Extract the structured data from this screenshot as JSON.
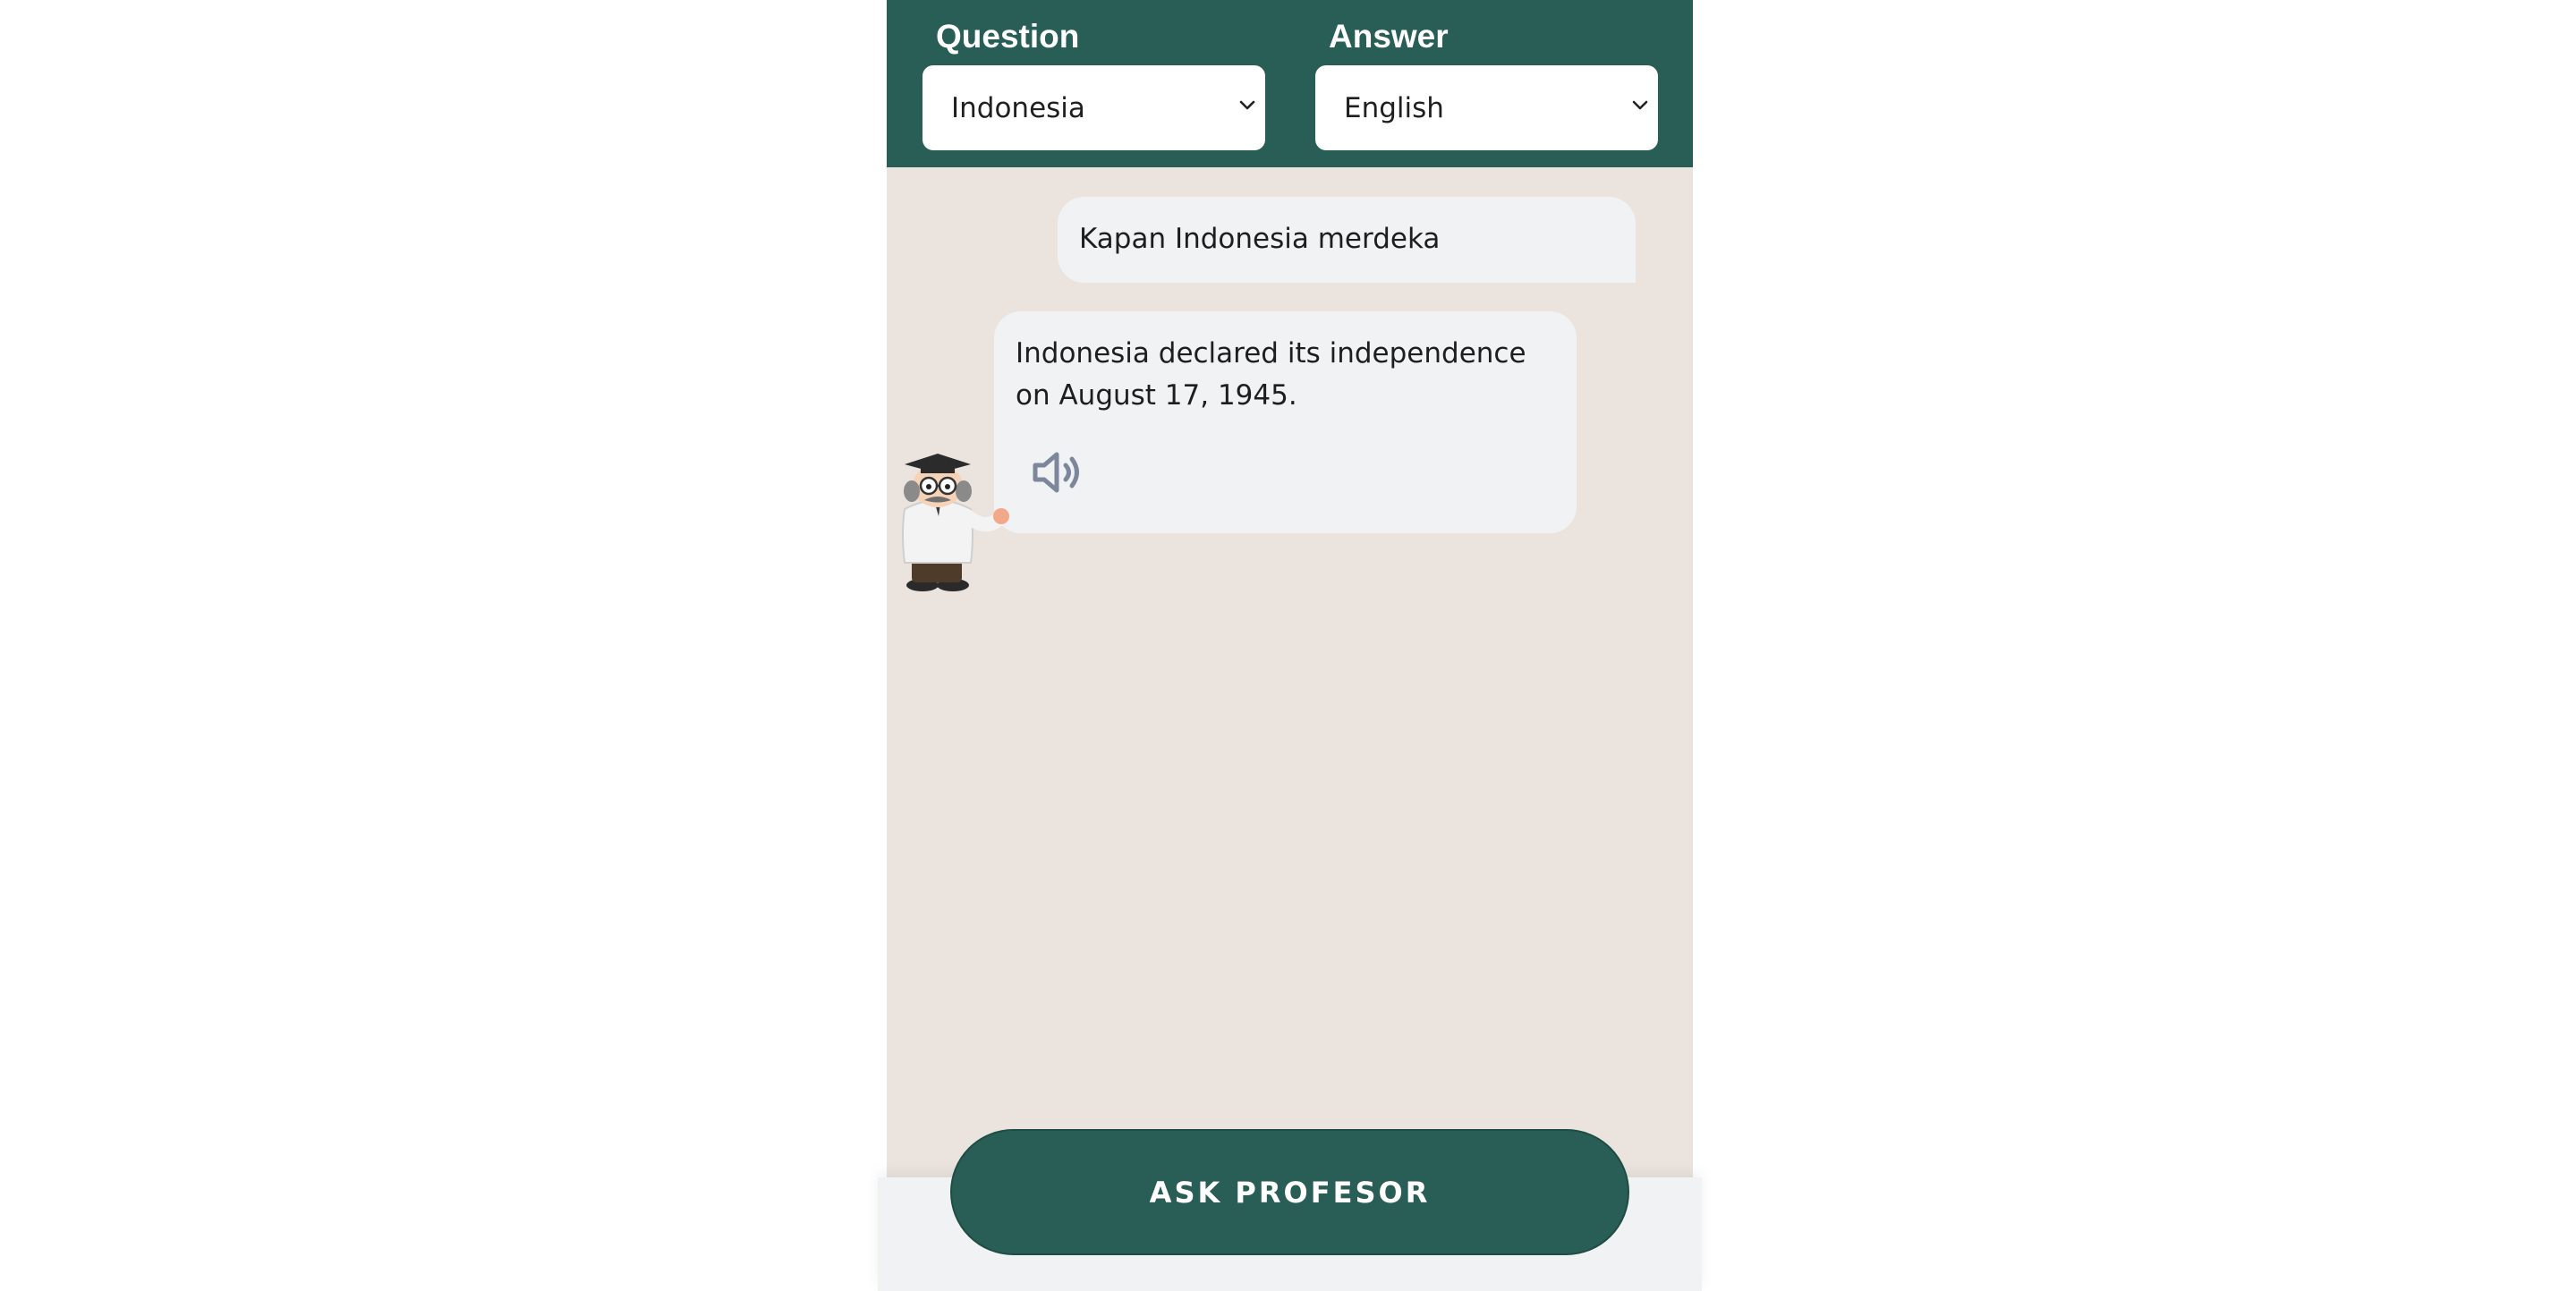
{
  "header": {
    "question_label": "Question",
    "answer_label": "Answer",
    "question_language": {
      "selected": "Indonesia"
    },
    "answer_language": {
      "selected": "English"
    }
  },
  "chat": {
    "messages": [
      {
        "role": "user",
        "text": "Kapan Indonesia merdeka"
      },
      {
        "role": "assistant",
        "text": "Indonesia declared its independence on August 17, 1945.",
        "action_icon": "speaker-icon"
      }
    ],
    "avatar": "professor-avatar"
  },
  "footer": {
    "ask_button_label": "ASK PROFESOR"
  },
  "colors": {
    "brand_green": "#285e55",
    "chat_background": "#ebe4de",
    "bubble_background": "#f1f2f4",
    "speaker_icon": "#7c879b"
  }
}
